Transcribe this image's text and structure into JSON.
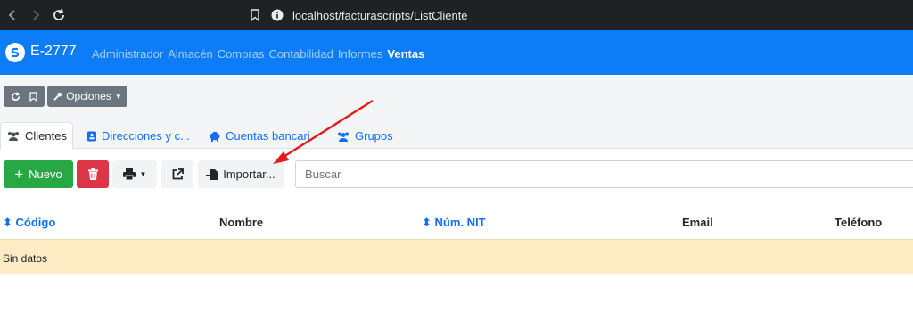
{
  "browser": {
    "url": "localhost/facturascripts/ListCliente"
  },
  "navbar": {
    "brand": "E-2777",
    "items": [
      {
        "label": "Administrador",
        "active": false
      },
      {
        "label": "Almacén",
        "active": false
      },
      {
        "label": "Compras",
        "active": false
      },
      {
        "label": "Contabilidad",
        "active": false
      },
      {
        "label": "Informes",
        "active": false
      },
      {
        "label": "Ventas",
        "active": true
      }
    ]
  },
  "top_actions": {
    "options_label": "Opciones"
  },
  "tabs": [
    {
      "label": "Clientes",
      "icon": "users-icon",
      "active": true
    },
    {
      "label": "Direcciones y c...",
      "icon": "address-card-icon",
      "active": false
    },
    {
      "label": "Cuentas bancari",
      "icon": "piggy-bank-icon",
      "active": false
    },
    {
      "label": "Grupos",
      "icon": "users-group-icon",
      "active": false
    }
  ],
  "toolbar": {
    "new_label": "Nuevo",
    "import_label": "Importar...",
    "search_placeholder": "Buscar"
  },
  "table": {
    "columns": [
      {
        "label": "Código",
        "sortable": true
      },
      {
        "label": "Nombre",
        "sortable": false
      },
      {
        "label": "Núm. NIT",
        "sortable": true
      },
      {
        "label": "Email",
        "sortable": false
      },
      {
        "label": "Teléfono",
        "sortable": false
      }
    ],
    "empty_message": "Sin datos"
  },
  "colors": {
    "navbar": "#0d7cf7",
    "success": "#28a745",
    "danger": "#dc3545",
    "warning_row": "#fdebc3",
    "annotation_arrow": "#e31b1b"
  }
}
